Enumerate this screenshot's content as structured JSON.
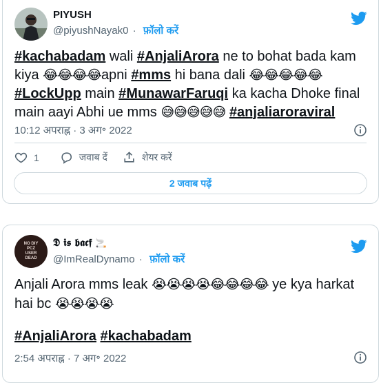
{
  "tweets": [
    {
      "name": "PIYUSH",
      "handle": "@piyushNayak0",
      "separator": "·",
      "follow": "फ़ॉलो करें",
      "text": [
        {
          "t": "tag",
          "v": "#kachabadam"
        },
        {
          "t": "txt",
          "v": "  wali "
        },
        {
          "t": "tag",
          "v": "#AnjaliArora"
        },
        {
          "t": "txt",
          "v": " ne to bohat bada kam kiya "
        },
        {
          "t": "emoji",
          "v": "😂😂😂😂"
        },
        {
          "t": "txt",
          "v": "apni "
        },
        {
          "t": "tag",
          "v": "#mms"
        },
        {
          "t": "txt",
          "v": " hi bana dali "
        },
        {
          "t": "emoji",
          "v": "😂😂😂😂😂"
        },
        {
          "t": "txt",
          "v": " "
        },
        {
          "t": "tag",
          "v": "#LockUpp"
        },
        {
          "t": "txt",
          "v": " main "
        },
        {
          "t": "tag",
          "v": "#MunawarFaruqi"
        },
        {
          "t": "txt",
          "v": "  ka kacha Dhoke final main aayi Abhi ue mms "
        },
        {
          "t": "emoji",
          "v": "😅😅😅😅😅"
        },
        {
          "t": "txt",
          "v": " "
        },
        {
          "t": "tag",
          "v": "#anjaliaroraviral"
        }
      ],
      "timestamp": "10:12 अपराह्न · 3 अग॰ 2022",
      "likes": "1",
      "reply_label": "जवाब दें",
      "share_label": "शेयर करें",
      "read_replies": "2 जवाब पढ़ें"
    },
    {
      "name": "𝕯 𝖎𝖘 𝖇𝖆𝖈𝖋",
      "name_suffix": "🚬",
      "avatar_text": [
        "NO DIY",
        "PCZ",
        "USER",
        "DEAD"
      ],
      "handle": "@ImRealDynamo",
      "separator": "·",
      "follow": "फ़ॉलो करें",
      "text": [
        {
          "t": "txt",
          "v": "Anjali Arora mms leak "
        },
        {
          "t": "emoji",
          "v": "😭😭😭😭😂😂😂😂"
        },
        {
          "t": "txt",
          "v": " ye kya harkat hai bc "
        },
        {
          "t": "emoji",
          "v": "😭😭😭😭"
        }
      ],
      "tags_line": [
        {
          "t": "tag",
          "v": "#AnjaliArora"
        },
        {
          "t": "txt",
          "v": " "
        },
        {
          "t": "tag",
          "v": "#kachabadam"
        }
      ],
      "timestamp": "2:54 अपराह्न · 7 अग॰ 2022"
    }
  ],
  "colors": {
    "accent": "#1d9bf0",
    "secondary_text": "#536471",
    "border": "#cfd9de"
  },
  "icons": [
    "twitter-bird-icon",
    "info-icon",
    "heart-icon",
    "reply-icon",
    "share-icon"
  ]
}
